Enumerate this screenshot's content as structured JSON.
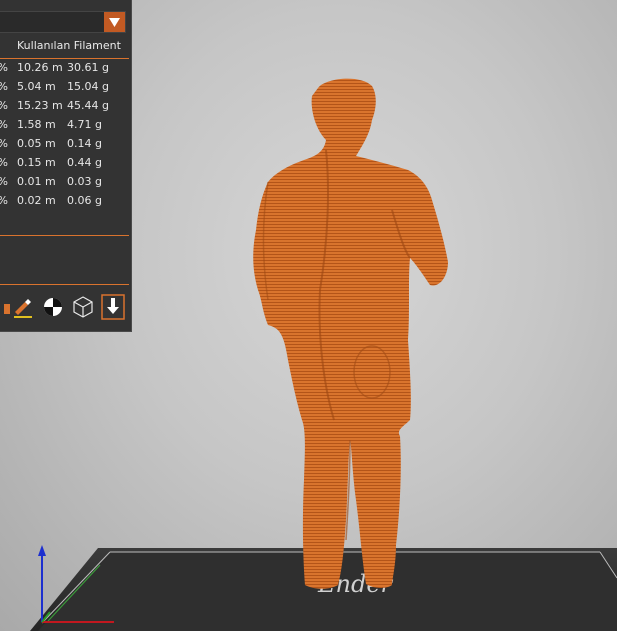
{
  "legend": {
    "column_header": "Kullanılan Filament",
    "rows": [
      {
        "pct": "%",
        "length": "10.26 m",
        "weight": "30.61 g"
      },
      {
        "pct": "%",
        "length": "5.04 m",
        "weight": "15.04 g"
      },
      {
        "pct": "%",
        "length": "15.23 m",
        "weight": "45.44 g"
      },
      {
        "pct": "%",
        "length": "1.58 m",
        "weight": "4.71 g"
      },
      {
        "pct": "%",
        "length": "0.05 m",
        "weight": "0.14 g"
      },
      {
        "pct": "%",
        "length": "0.15 m",
        "weight": "0.44 g"
      },
      {
        "pct": "%",
        "length": "0.01 m",
        "weight": "0.03 g"
      },
      {
        "pct": "%",
        "length": "0.02 m",
        "weight": "0.06 g"
      }
    ]
  },
  "toolbar_icons": [
    "paint-brush-icon",
    "half-circle-icon",
    "wireframe-cube-icon",
    "export-icon"
  ],
  "colors": {
    "accent": "#c25a23",
    "model": "#d6732e",
    "panel": "#333333",
    "bed": "#2b2b2b"
  },
  "bed": {
    "logo_text": "Ender"
  }
}
